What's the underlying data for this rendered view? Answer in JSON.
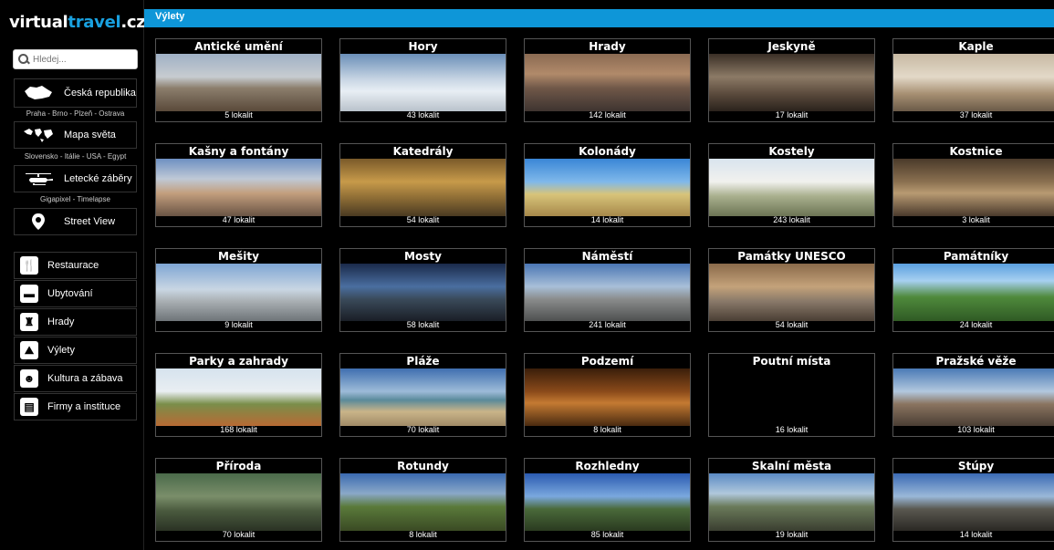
{
  "logo": {
    "part1": "virtual",
    "part2": "travel",
    "part3": ".cz"
  },
  "search": {
    "placeholder": "Hledej..."
  },
  "destinations": [
    {
      "label": "Česká republika",
      "icon": "czech-map-icon"
    },
    {
      "label": "Mapa světa",
      "icon": "world-map-icon"
    },
    {
      "label": "Letecké záběry",
      "icon": "helicopter-icon"
    },
    {
      "label": "Street View",
      "icon": "location-pin-icon"
    }
  ],
  "sublinks": [
    "Praha - Brno - Plzeň - Ostrava",
    "Slovensko - Itálie - USA - Egypt",
    "Gigapixel - Timelapse"
  ],
  "services": [
    {
      "label": "Restaurace",
      "icon": "restaurant-icon",
      "glyph": "🍴"
    },
    {
      "label": "Ubytování",
      "icon": "bed-icon",
      "glyph": "▬"
    },
    {
      "label": "Hrady",
      "icon": "castle-icon",
      "glyph": "♜"
    },
    {
      "label": "Výlety",
      "icon": "hiking-icon",
      "glyph": "⛰"
    },
    {
      "label": "Kultura a zábava",
      "icon": "theater-mask-icon",
      "glyph": "☻"
    },
    {
      "label": "Firmy a instituce",
      "icon": "institution-icon",
      "glyph": "▤"
    }
  ],
  "header": {
    "title": "Výlety"
  },
  "categories": [
    {
      "title": "Antické umění",
      "count": "5 lokalit",
      "style": "arch"
    },
    {
      "title": "Hory",
      "count": "43 lokalit",
      "style": "snow"
    },
    {
      "title": "Hrady",
      "count": "142 lokalit",
      "style": "city"
    },
    {
      "title": "Jeskyně",
      "count": "17 lokalit",
      "style": "cave"
    },
    {
      "title": "Kaple",
      "count": "37 lokalit",
      "style": "chapel"
    },
    {
      "title": "Kašny a fontány",
      "count": "47 lokalit",
      "style": "fountain"
    },
    {
      "title": "Katedrály",
      "count": "54 lokalit",
      "style": "cath"
    },
    {
      "title": "Kolonády",
      "count": "14 lokalit",
      "style": "colo"
    },
    {
      "title": "Kostely",
      "count": "243 lokalit",
      "style": "church"
    },
    {
      "title": "Kostnice",
      "count": "3 lokalit",
      "style": "ossuary"
    },
    {
      "title": "Mešity",
      "count": "9 lokalit",
      "style": "mosque"
    },
    {
      "title": "Mosty",
      "count": "58 lokalit",
      "style": "bridge"
    },
    {
      "title": "Náměstí",
      "count": "241 lokalit",
      "style": "square"
    },
    {
      "title": "Památky UNESCO",
      "count": "54 lokalit",
      "style": "unesco"
    },
    {
      "title": "Památníky",
      "count": "24 lokalit",
      "style": "monument"
    },
    {
      "title": "Parky a zahrady",
      "count": "168 lokalit",
      "style": "park"
    },
    {
      "title": "Pláže",
      "count": "70 lokalit",
      "style": "beach"
    },
    {
      "title": "Podzemí",
      "count": "8 lokalit",
      "style": "under"
    },
    {
      "title": "Poutní místa",
      "count": "16 lokalit",
      "style": "blank"
    },
    {
      "title": "Pražské věže",
      "count": "103 lokalit",
      "style": "towers"
    },
    {
      "title": "Příroda",
      "count": "70 lokalit",
      "style": "nature"
    },
    {
      "title": "Rotundy",
      "count": "8 lokalit",
      "style": "rotunda"
    },
    {
      "title": "Rozhledny",
      "count": "85 lokalit",
      "style": "lookout"
    },
    {
      "title": "Skalní města",
      "count": "19 lokalit",
      "style": "rock"
    },
    {
      "title": "Stúpy",
      "count": "14 lokalit",
      "style": "steps"
    }
  ]
}
